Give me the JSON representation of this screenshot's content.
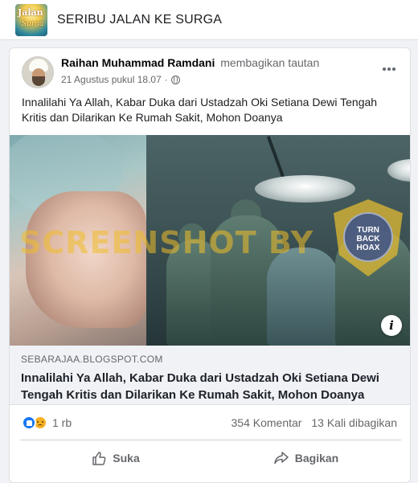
{
  "page": {
    "name": "SERIBU JALAN KE SURGA",
    "logo_text": "Jalan",
    "logo_sub": "Surga"
  },
  "post": {
    "author": "Raihan Muhammad Ramdani",
    "action": "membagikan tautan",
    "timestamp": "21 Agustus pukul 18.07",
    "audience_icon": "globe-icon",
    "text": "Innalilahi Ya Allah, Kabar Duka dari Ustadzah Oki Setiana Dewi Tengah Kritis dan Dilarikan Ke Rumah Sakit, Mohon Doanya",
    "image": {
      "watermark": "SCREENSHOT BY",
      "badge_text": "TURN BACK HOAX"
    },
    "link": {
      "domain": "SEBARAJAA.BLOGSPOT.COM",
      "title": "Innalilahi Ya Allah, Kabar Duka dari Ustadzah Oki Setiana Dewi Tengah Kritis dan Dilarikan Ke Rumah Sakit, Mohon Doanya"
    },
    "reactions": {
      "types": [
        "like",
        "sad"
      ],
      "count": "1 rb"
    },
    "comments": "354 Komentar",
    "shares": "13 Kali dibagikan",
    "actions": {
      "like": "Suka",
      "share": "Bagikan"
    }
  },
  "colors": {
    "accent": "#1877f2",
    "muted_text": "#65676b",
    "background": "#f0f2f5"
  }
}
